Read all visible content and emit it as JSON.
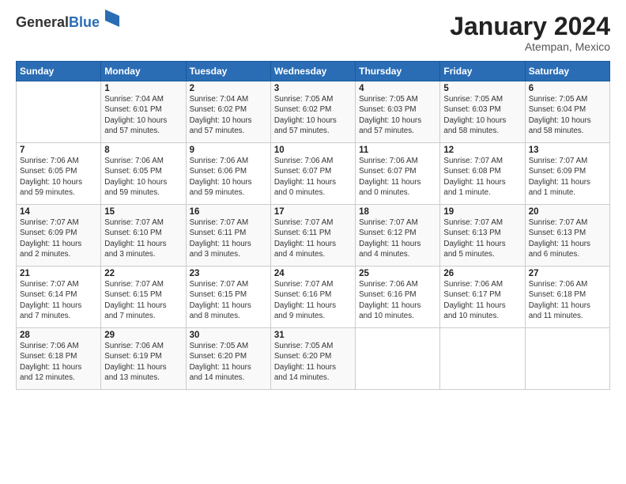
{
  "logo": {
    "general": "General",
    "blue": "Blue"
  },
  "header": {
    "month_year": "January 2024",
    "location": "Atempan, Mexico"
  },
  "weekdays": [
    "Sunday",
    "Monday",
    "Tuesday",
    "Wednesday",
    "Thursday",
    "Friday",
    "Saturday"
  ],
  "weeks": [
    [
      {
        "day": "",
        "info": ""
      },
      {
        "day": "1",
        "info": "Sunrise: 7:04 AM\nSunset: 6:01 PM\nDaylight: 10 hours\nand 57 minutes."
      },
      {
        "day": "2",
        "info": "Sunrise: 7:04 AM\nSunset: 6:02 PM\nDaylight: 10 hours\nand 57 minutes."
      },
      {
        "day": "3",
        "info": "Sunrise: 7:05 AM\nSunset: 6:02 PM\nDaylight: 10 hours\nand 57 minutes."
      },
      {
        "day": "4",
        "info": "Sunrise: 7:05 AM\nSunset: 6:03 PM\nDaylight: 10 hours\nand 57 minutes."
      },
      {
        "day": "5",
        "info": "Sunrise: 7:05 AM\nSunset: 6:03 PM\nDaylight: 10 hours\nand 58 minutes."
      },
      {
        "day": "6",
        "info": "Sunrise: 7:05 AM\nSunset: 6:04 PM\nDaylight: 10 hours\nand 58 minutes."
      }
    ],
    [
      {
        "day": "7",
        "info": "Sunrise: 7:06 AM\nSunset: 6:05 PM\nDaylight: 10 hours\nand 59 minutes."
      },
      {
        "day": "8",
        "info": "Sunrise: 7:06 AM\nSunset: 6:05 PM\nDaylight: 10 hours\nand 59 minutes."
      },
      {
        "day": "9",
        "info": "Sunrise: 7:06 AM\nSunset: 6:06 PM\nDaylight: 10 hours\nand 59 minutes."
      },
      {
        "day": "10",
        "info": "Sunrise: 7:06 AM\nSunset: 6:07 PM\nDaylight: 11 hours\nand 0 minutes."
      },
      {
        "day": "11",
        "info": "Sunrise: 7:06 AM\nSunset: 6:07 PM\nDaylight: 11 hours\nand 0 minutes."
      },
      {
        "day": "12",
        "info": "Sunrise: 7:07 AM\nSunset: 6:08 PM\nDaylight: 11 hours\nand 1 minute."
      },
      {
        "day": "13",
        "info": "Sunrise: 7:07 AM\nSunset: 6:09 PM\nDaylight: 11 hours\nand 1 minute."
      }
    ],
    [
      {
        "day": "14",
        "info": "Sunrise: 7:07 AM\nSunset: 6:09 PM\nDaylight: 11 hours\nand 2 minutes."
      },
      {
        "day": "15",
        "info": "Sunrise: 7:07 AM\nSunset: 6:10 PM\nDaylight: 11 hours\nand 3 minutes."
      },
      {
        "day": "16",
        "info": "Sunrise: 7:07 AM\nSunset: 6:11 PM\nDaylight: 11 hours\nand 3 minutes."
      },
      {
        "day": "17",
        "info": "Sunrise: 7:07 AM\nSunset: 6:11 PM\nDaylight: 11 hours\nand 4 minutes."
      },
      {
        "day": "18",
        "info": "Sunrise: 7:07 AM\nSunset: 6:12 PM\nDaylight: 11 hours\nand 4 minutes."
      },
      {
        "day": "19",
        "info": "Sunrise: 7:07 AM\nSunset: 6:13 PM\nDaylight: 11 hours\nand 5 minutes."
      },
      {
        "day": "20",
        "info": "Sunrise: 7:07 AM\nSunset: 6:13 PM\nDaylight: 11 hours\nand 6 minutes."
      }
    ],
    [
      {
        "day": "21",
        "info": "Sunrise: 7:07 AM\nSunset: 6:14 PM\nDaylight: 11 hours\nand 7 minutes."
      },
      {
        "day": "22",
        "info": "Sunrise: 7:07 AM\nSunset: 6:15 PM\nDaylight: 11 hours\nand 7 minutes."
      },
      {
        "day": "23",
        "info": "Sunrise: 7:07 AM\nSunset: 6:15 PM\nDaylight: 11 hours\nand 8 minutes."
      },
      {
        "day": "24",
        "info": "Sunrise: 7:07 AM\nSunset: 6:16 PM\nDaylight: 11 hours\nand 9 minutes."
      },
      {
        "day": "25",
        "info": "Sunrise: 7:06 AM\nSunset: 6:16 PM\nDaylight: 11 hours\nand 10 minutes."
      },
      {
        "day": "26",
        "info": "Sunrise: 7:06 AM\nSunset: 6:17 PM\nDaylight: 11 hours\nand 10 minutes."
      },
      {
        "day": "27",
        "info": "Sunrise: 7:06 AM\nSunset: 6:18 PM\nDaylight: 11 hours\nand 11 minutes."
      }
    ],
    [
      {
        "day": "28",
        "info": "Sunrise: 7:06 AM\nSunset: 6:18 PM\nDaylight: 11 hours\nand 12 minutes."
      },
      {
        "day": "29",
        "info": "Sunrise: 7:06 AM\nSunset: 6:19 PM\nDaylight: 11 hours\nand 13 minutes."
      },
      {
        "day": "30",
        "info": "Sunrise: 7:05 AM\nSunset: 6:20 PM\nDaylight: 11 hours\nand 14 minutes."
      },
      {
        "day": "31",
        "info": "Sunrise: 7:05 AM\nSunset: 6:20 PM\nDaylight: 11 hours\nand 14 minutes."
      },
      {
        "day": "",
        "info": ""
      },
      {
        "day": "",
        "info": ""
      },
      {
        "day": "",
        "info": ""
      }
    ]
  ]
}
